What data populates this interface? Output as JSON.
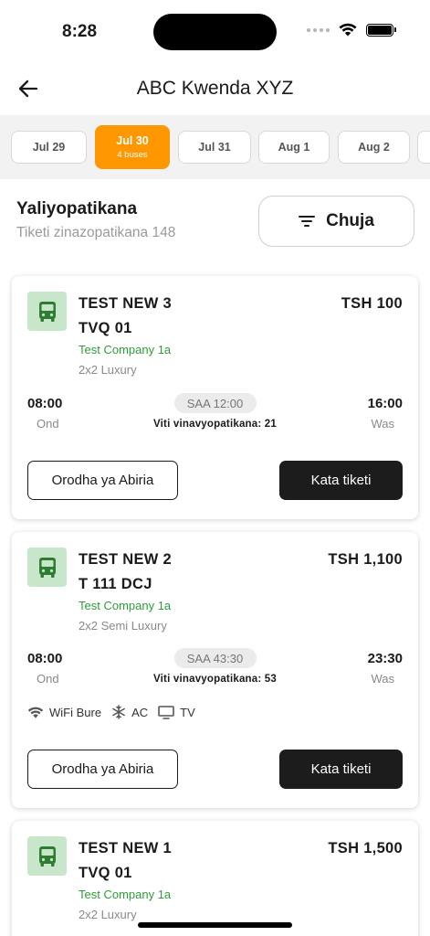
{
  "status_bar": {
    "time": "8:28"
  },
  "header": {
    "title": "ABC Kwenda XYZ"
  },
  "dates": [
    {
      "label": "Jul 29",
      "sub": "",
      "active": false
    },
    {
      "label": "Jul 30",
      "sub": "4 buses",
      "active": true
    },
    {
      "label": "Jul 31",
      "sub": "",
      "active": false
    },
    {
      "label": "Aug 1",
      "sub": "",
      "active": false
    },
    {
      "label": "Aug 2",
      "sub": "",
      "active": false
    }
  ],
  "summary": {
    "title": "Yaliyopatikana",
    "count": "Tiketi zinazopatikana 148",
    "filter_label": "Chuja"
  },
  "buses": [
    {
      "name": "TEST NEW 3",
      "plate": "TVQ 01",
      "company": "Test Company 1a",
      "class": "2x2 Luxury",
      "price": "TSH 100",
      "departure_time": "08:00",
      "departure_label": "Ond",
      "arrival_time": "16:00",
      "arrival_label": "Was",
      "duration": "SAA 12:00",
      "seats": "Viti vinavyopatikana: 21",
      "amenities": [],
      "passengers_label": "Orodha ya Abiria",
      "book_label": "Kata tiketi"
    },
    {
      "name": "TEST NEW 2",
      "plate": "T 111 DCJ",
      "company": "Test Company 1a",
      "class": "2x2 Semi Luxury",
      "price": "TSH 1,100",
      "departure_time": "08:00",
      "departure_label": "Ond",
      "arrival_time": "23:30",
      "arrival_label": "Was",
      "duration": "SAA 43:30",
      "seats": "Viti vinavyopatikana: 53",
      "amenities": [
        {
          "icon": "wifi-icon",
          "label": "WiFi Bure"
        },
        {
          "icon": "snowflake-icon",
          "label": "AC"
        },
        {
          "icon": "tv-icon",
          "label": "TV"
        }
      ],
      "passengers_label": "Orodha ya Abiria",
      "book_label": "Kata tiketi"
    },
    {
      "name": "TEST NEW 1",
      "plate": "TVQ 01",
      "company": "Test Company 1a",
      "class": "2x2 Luxury",
      "price": "TSH 1,500"
    }
  ],
  "colors": {
    "accent": "#ff9800",
    "company_green": "#2e9d38",
    "bus_icon_bg": "#c8e6c9",
    "bus_icon": "#2e7d32",
    "primary_button": "#1c1c1c"
  }
}
